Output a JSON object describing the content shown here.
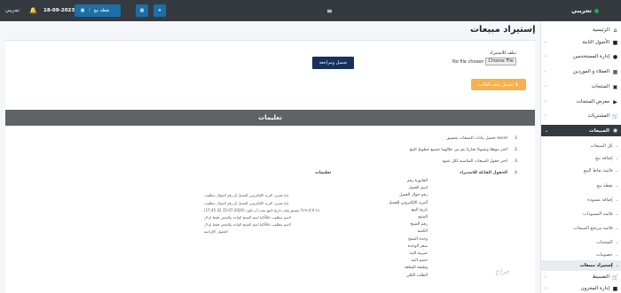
{
  "topbar": {
    "brand": "تجريبي",
    "menu_icon": "bars-icon",
    "user": "تجريبي",
    "date": "18-09-2023",
    "btn_pos": "نقطة بيع",
    "btn_pos_icon": "cart-icon",
    "btn_money_icon": "money-icon",
    "btn_calc_icon": "calculator-icon",
    "btn_plus_icon": "plus-icon",
    "bell_icon": "bell-icon"
  },
  "sidebar": {
    "items": [
      {
        "label": "الرئيسية",
        "icon": "home-icon"
      },
      {
        "label": "الأصول الثابتة",
        "icon": "building-icon"
      },
      {
        "label": "إدارة المستخدمين",
        "icon": "users-icon"
      },
      {
        "label": "العملاء و الموردين",
        "icon": "address-book-icon"
      },
      {
        "label": "المنتجات",
        "icon": "box-icon"
      },
      {
        "label": "معرض المنتجات",
        "icon": "truck-icon"
      },
      {
        "label": "المشتريات",
        "icon": "cart-icon"
      },
      {
        "label": "المبيعات",
        "icon": "sales-icon"
      }
    ],
    "sales_sub": [
      "كل المبيعات",
      "إضافة بيع",
      "قائمة نقاط البيع",
      "نقطة بيع",
      "إضافة مسودة",
      "قائمة المسودات",
      "قائمة مرتجع المبيعات",
      "الشحنات",
      "خصومات",
      "إستيراد مبيعات"
    ],
    "after": [
      {
        "label": "التقسيط",
        "icon": "cart-icon"
      },
      {
        "label": "إدارة المخزون",
        "icon": "warehouse-icon"
      }
    ]
  },
  "main": {
    "title": "إستيراد مبيعات",
    "file_label": "ملف للاستيراد:",
    "file_button": "Choose File",
    "file_status": "No file chosen",
    "submit": "تحميل ومراجعة",
    "download_template": "تحميل ملف القالب",
    "instructions_header": "تعليمات",
    "instructions": [
      {
        "num": "1.",
        "text": "تحميل بيانات المبيعات بتنسيق excel"
      },
      {
        "num": "2.",
        "text": "اختر موقعًا وعمودًا تجاريًا يتم من خلالهما تجميع خطوط البيع"
      },
      {
        "num": "3.",
        "text": "اختر حقول المبيعات المناسبة لكل عمود"
      },
      {
        "num": "4.",
        "text": "الحقول القابلة للاستيراد"
      }
    ],
    "fields_header": "تعليمات",
    "fields": [
      {
        "name": "الفاتورة رقم",
        "desc": ""
      },
      {
        "name": "اسم العميل",
        "desc": ""
      },
      {
        "name": "رقم جوال العميل",
        "desc": "إما معرف البريد الإلكتروني للعميل أو رقم الجوال مطلوب"
      },
      {
        "name": "البريد الإلكتروني للعميل",
        "desc": "إما معرف البريد الإلكتروني للعميل أو رقم الجوال مطلوب"
      },
      {
        "name": "تاريخ البيع",
        "desc": "تنسيق وقت تاريخ البيع يجب أن يكون (2020-07-15 17:45:32) Y-m-d H:i:s"
      },
      {
        "name": "المنتج",
        "desc": "إما اسم المنتج الواحد والبعض فقط او الSku لاسم مطلوب"
      },
      {
        "name": "رقم المنتج",
        "desc": "إما اسم المنتج الواحد والبعض فقط او الSku لاسم مطلوب"
      },
      {
        "name": "الكمية",
        "desc": "الحقول الإلزامية"
      },
      {
        "name": "وحدة المنتج",
        "desc": ""
      },
      {
        "name": "سعر الوحدة",
        "desc": ""
      },
      {
        "name": "ضريبة البند",
        "desc": ""
      },
      {
        "name": "خصم البند",
        "desc": ""
      },
      {
        "name": "وظيفة السلعة",
        "desc": ""
      },
      {
        "name": "الطلب الكلي",
        "desc": ""
      }
    ],
    "watermark": "حراج"
  }
}
